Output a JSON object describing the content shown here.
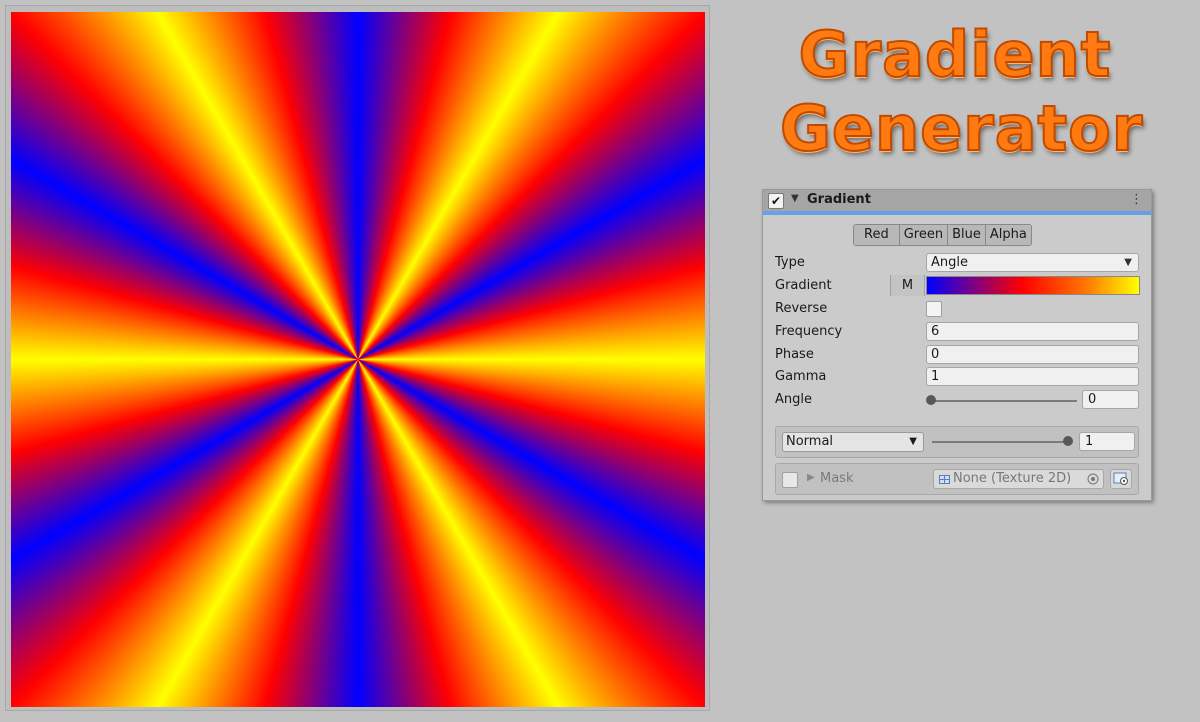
{
  "logo": {
    "line1": "Gradient",
    "line2": "Generator"
  },
  "colors": {
    "accent": "#6a9ee8",
    "logo_orange": "#ff7a10",
    "blue": "#0000ff",
    "red": "#ff0000",
    "yellow": "#ffff00"
  },
  "inspector": {
    "header": {
      "checked_glyph": "✔",
      "arrow": "▼",
      "title": "Gradient",
      "menu": "⋮"
    },
    "tabs": [
      "Red",
      "Green",
      "Blue",
      "Alpha"
    ],
    "fields": {
      "type": {
        "label": "Type",
        "value": "Angle",
        "caret": "▼"
      },
      "gradient": {
        "label": "Gradient",
        "mode_button": "M"
      },
      "reverse": {
        "label": "Reverse",
        "checked": false
      },
      "frequency": {
        "label": "Frequency",
        "value": "6"
      },
      "phase": {
        "label": "Phase",
        "value": "0"
      },
      "gamma": {
        "label": "Gamma",
        "value": "1"
      },
      "angle": {
        "label": "Angle",
        "value": "0",
        "slider_fraction": 0
      }
    },
    "blend": {
      "mode": "Normal",
      "caret": "▼",
      "opacity": "1",
      "slider_fraction": 1
    },
    "mask": {
      "arrow": "▶",
      "label": "Mask",
      "texture": "None (Texture 2D)",
      "texture_icon": "texture-icon",
      "target_icon": "target-icon",
      "picker_icon": "object-picker-icon"
    }
  }
}
